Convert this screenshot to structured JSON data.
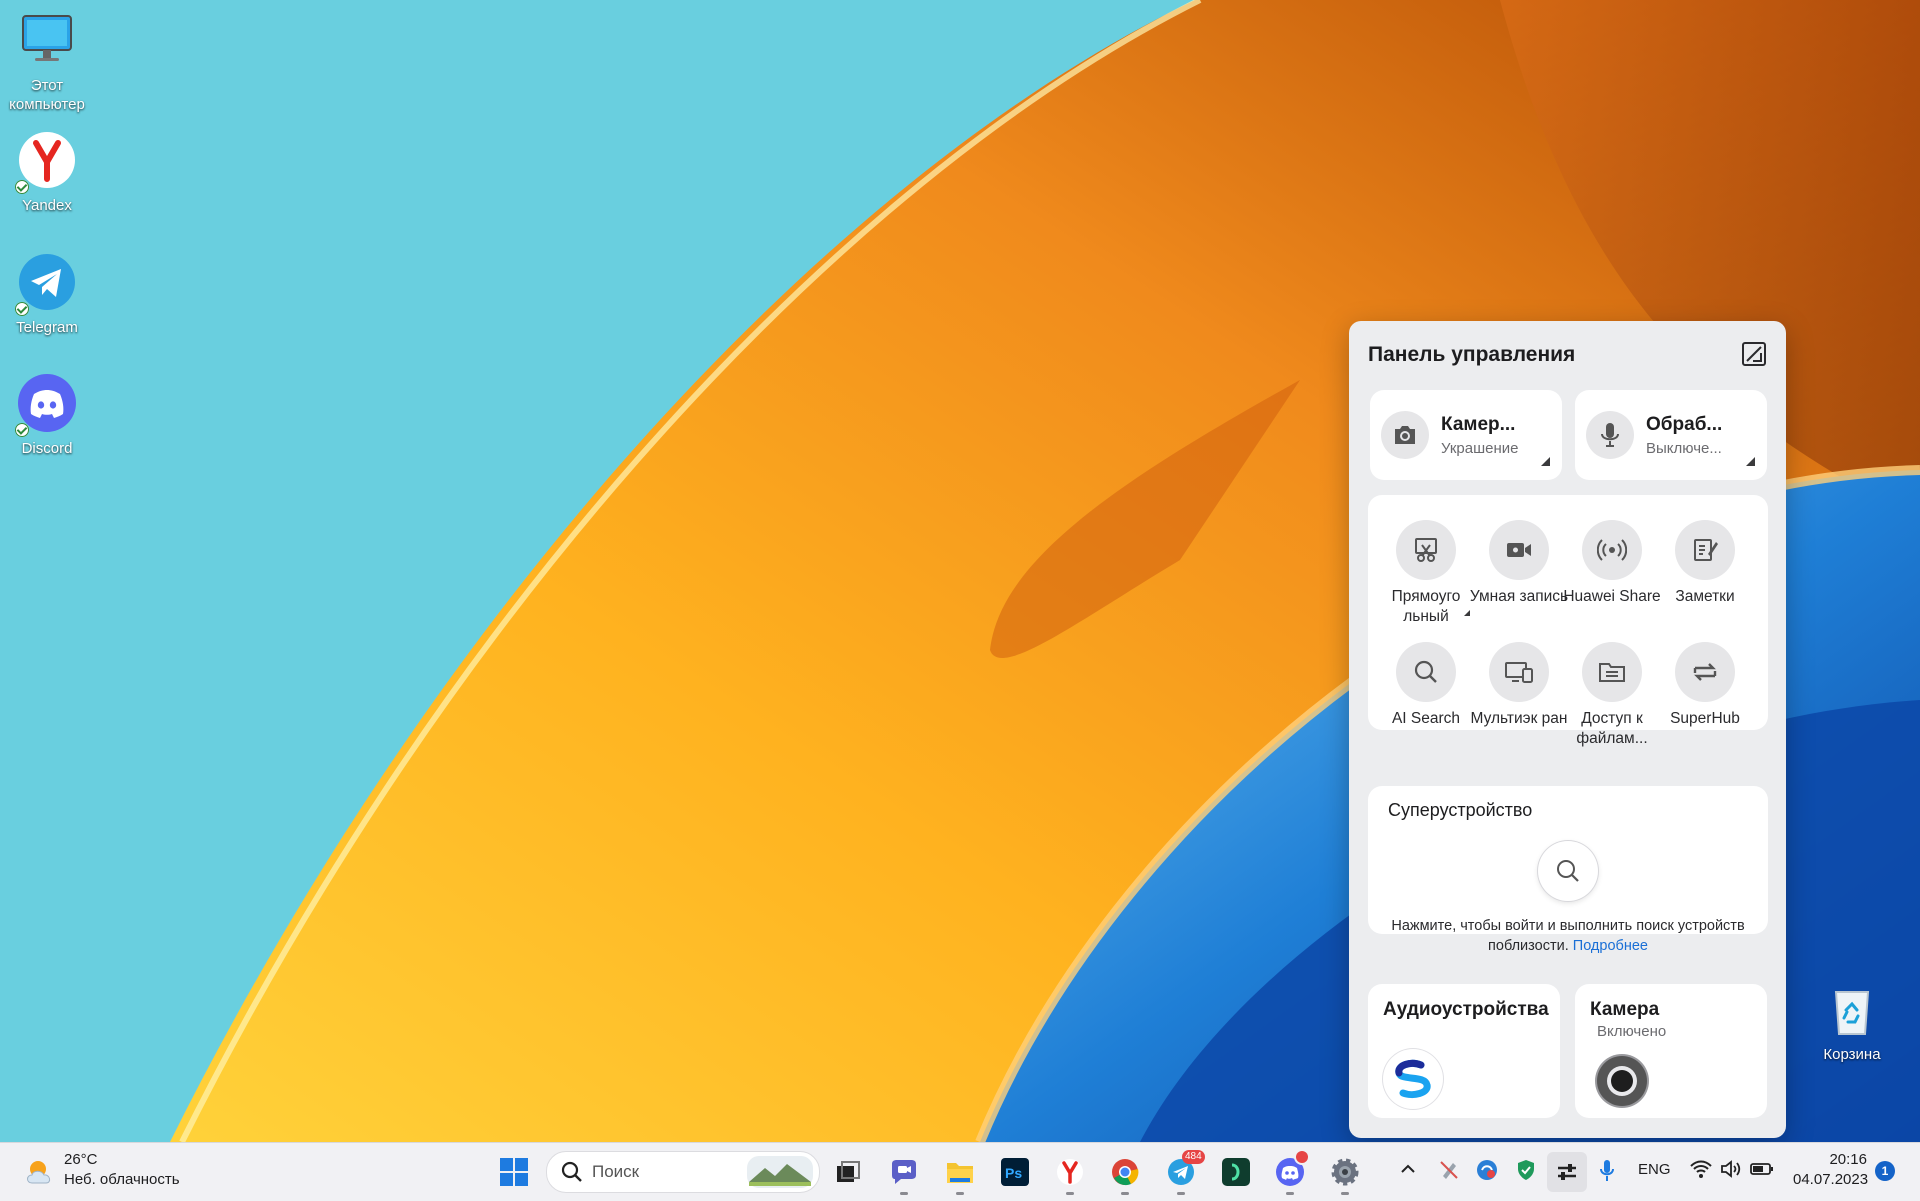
{
  "desktop": {
    "icons": [
      {
        "label": "Этот компьютер"
      },
      {
        "label": "Yandex"
      },
      {
        "label": "Telegram"
      },
      {
        "label": "Discord"
      }
    ],
    "recycle_bin": {
      "label": "Корзина"
    }
  },
  "control_panel": {
    "title": "Панель управления",
    "camera_pill": {
      "title": "Камер...",
      "subtitle": "Украшение"
    },
    "mic_pill": {
      "title": "Обраб...",
      "subtitle": "Выключе..."
    },
    "tiles": [
      {
        "label": "Прямоуго льный",
        "icon": "screenshot-icon"
      },
      {
        "label": "Умная запись",
        "icon": "video-camera-icon"
      },
      {
        "label": "Huawei Share",
        "icon": "broadcast-icon"
      },
      {
        "label": "Заметки",
        "icon": "notes-icon"
      },
      {
        "label": "AI Search",
        "icon": "search-icon"
      },
      {
        "label": "Мультиэк ран",
        "icon": "multiscreen-icon"
      },
      {
        "label": "Доступ к файлам...",
        "icon": "folder-icon"
      },
      {
        "label": "SuperHub",
        "icon": "superhub-icon"
      }
    ],
    "superdevice": {
      "title": "Суперустройство",
      "hint": "Нажмите, чтобы войти и выполнить поиск устройств поблизости.",
      "link": "Подробнее"
    },
    "audio": {
      "title": "Аудиоустройства"
    },
    "camera": {
      "title": "Камера",
      "status": "Включено"
    }
  },
  "taskbar": {
    "weather": {
      "temp": "26°C",
      "desc": "Неб. облачность"
    },
    "search_placeholder": "Поиск",
    "telegram_badge": "484",
    "language": "ENG",
    "time": "20:16",
    "date": "04.07.2023",
    "notification_count": "1"
  },
  "colors": {
    "accent": "#1463c8",
    "link": "#1a6fd6",
    "panel_bg": "#ecedef"
  }
}
